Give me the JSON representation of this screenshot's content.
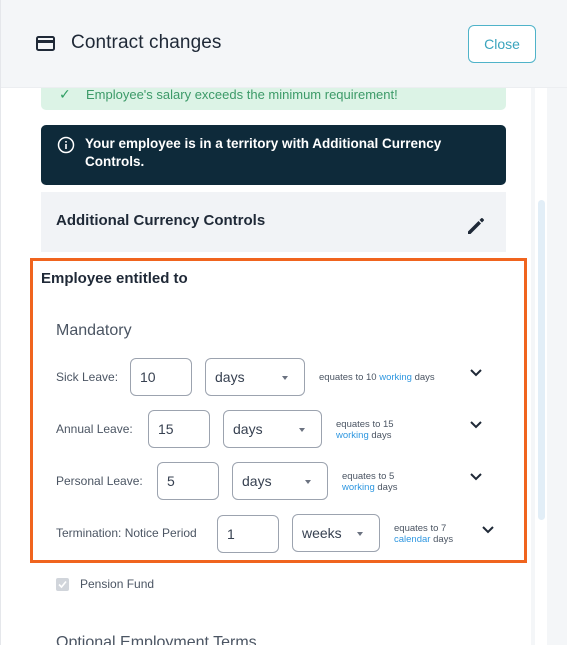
{
  "header": {
    "title": "Contract changes",
    "close_label": "Close",
    "icon": "credit-card-icon"
  },
  "alerts": {
    "success": "Employee's salary exceeds the minimum requirement!",
    "info": "Your employee is in a territory with Additional Currency Controls."
  },
  "currency_controls": {
    "label": "Additional Currency Controls",
    "icon": "pencil-icon"
  },
  "entitlements": {
    "title": "Employee entitled to",
    "mandatory_title": "Mandatory",
    "rows": [
      {
        "label": "Sick Leave:",
        "value": "10",
        "unit": "days",
        "equates_prefix": "equates to 10",
        "equates_kind": "working",
        "equates_suffix": "days"
      },
      {
        "label": "Annual Leave:",
        "value": "15",
        "unit": "days",
        "equates_prefix": "equates to 15",
        "equates_kind": "working",
        "equates_suffix": "days"
      },
      {
        "label": "Personal Leave:",
        "value": "5",
        "unit": "days",
        "equates_prefix": "equates to 5",
        "equates_kind": "working",
        "equates_suffix": "days"
      },
      {
        "label": "Termination: Notice Period",
        "value": "1",
        "unit": "weeks",
        "equates_prefix": "equates to 7",
        "equates_kind": "calendar",
        "equates_suffix": "days"
      }
    ]
  },
  "pension": {
    "label": "Pension Fund",
    "checked": true
  },
  "optional_title": "Optional Employment Terms",
  "colors": {
    "accent": "#3aa4bd",
    "highlight": "#f0641e",
    "info_bg": "#0e2a3a",
    "success_bg": "#dcf3e6",
    "link": "#2f97e0"
  }
}
